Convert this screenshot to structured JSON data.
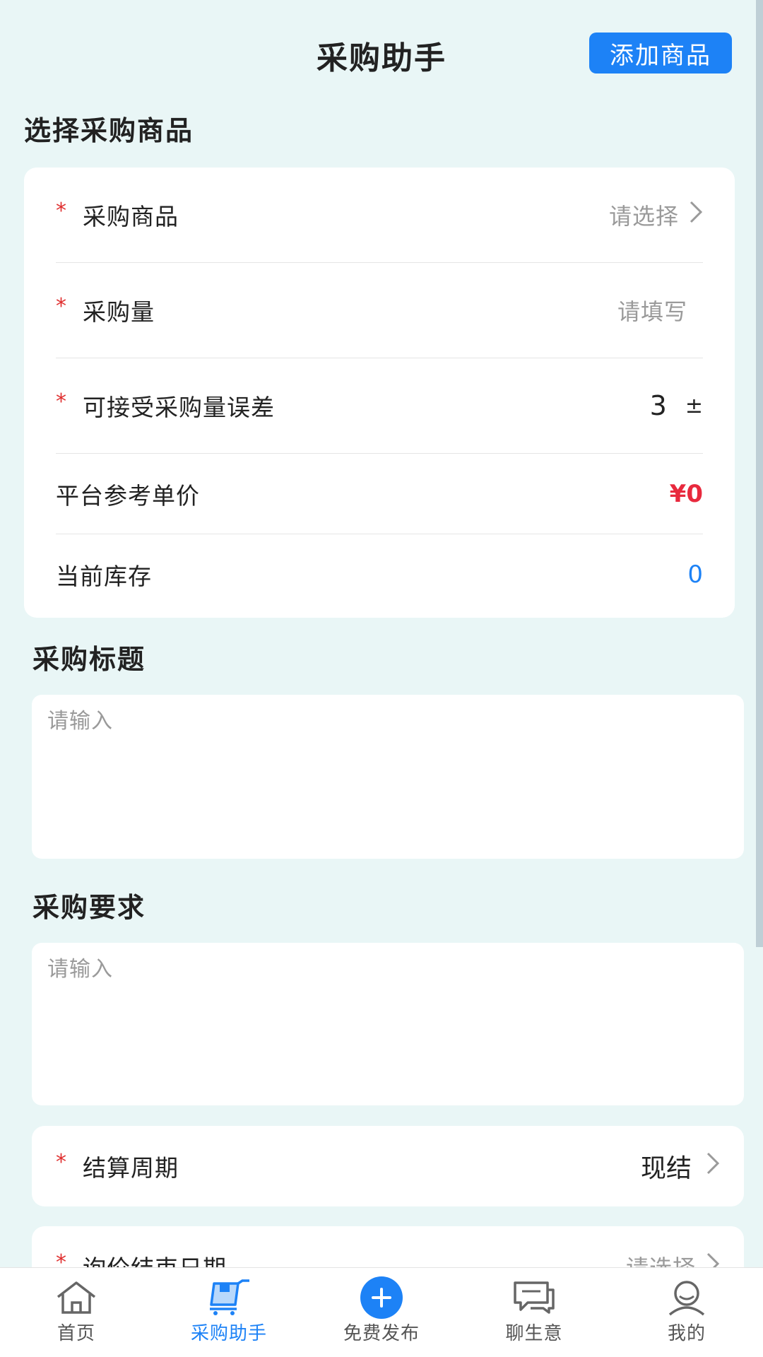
{
  "header": {
    "title": "采购助手",
    "add_button": "添加商品"
  },
  "select_section": {
    "title": "选择采购商品",
    "rows": {
      "product": {
        "label": "采购商品",
        "value": "请选择"
      },
      "quantity": {
        "label": "采购量",
        "placeholder": "请填写"
      },
      "tolerance": {
        "label": "可接受采购量误差",
        "value": "3",
        "unit": "±"
      },
      "price": {
        "label": "平台参考单价",
        "value": "¥0"
      },
      "stock": {
        "label": "当前库存",
        "value": "0"
      }
    },
    "required_mark": "*"
  },
  "purchase_title": {
    "title": "采购标题",
    "placeholder": "请输入"
  },
  "purchase_requirements": {
    "title": "采购要求",
    "placeholder": "请输入"
  },
  "settlement": {
    "label": "结算周期",
    "value": "现结"
  },
  "inquiry_end": {
    "label": "询价结束日期",
    "value": "请选择"
  },
  "bottom_nav": {
    "items": [
      {
        "label": "首页",
        "icon": "home-icon",
        "active": false
      },
      {
        "label": "采购助手",
        "icon": "cart-icon",
        "active": true
      },
      {
        "label": "免费发布",
        "icon": "plus-icon",
        "active": false
      },
      {
        "label": "聊生意",
        "icon": "chat-icon",
        "active": false
      },
      {
        "label": "我的",
        "icon": "user-icon",
        "active": false
      }
    ]
  },
  "colors": {
    "background": "#e9f6f6",
    "accent": "#1d82f6",
    "required": "#e03030",
    "price": "#e8293d"
  }
}
